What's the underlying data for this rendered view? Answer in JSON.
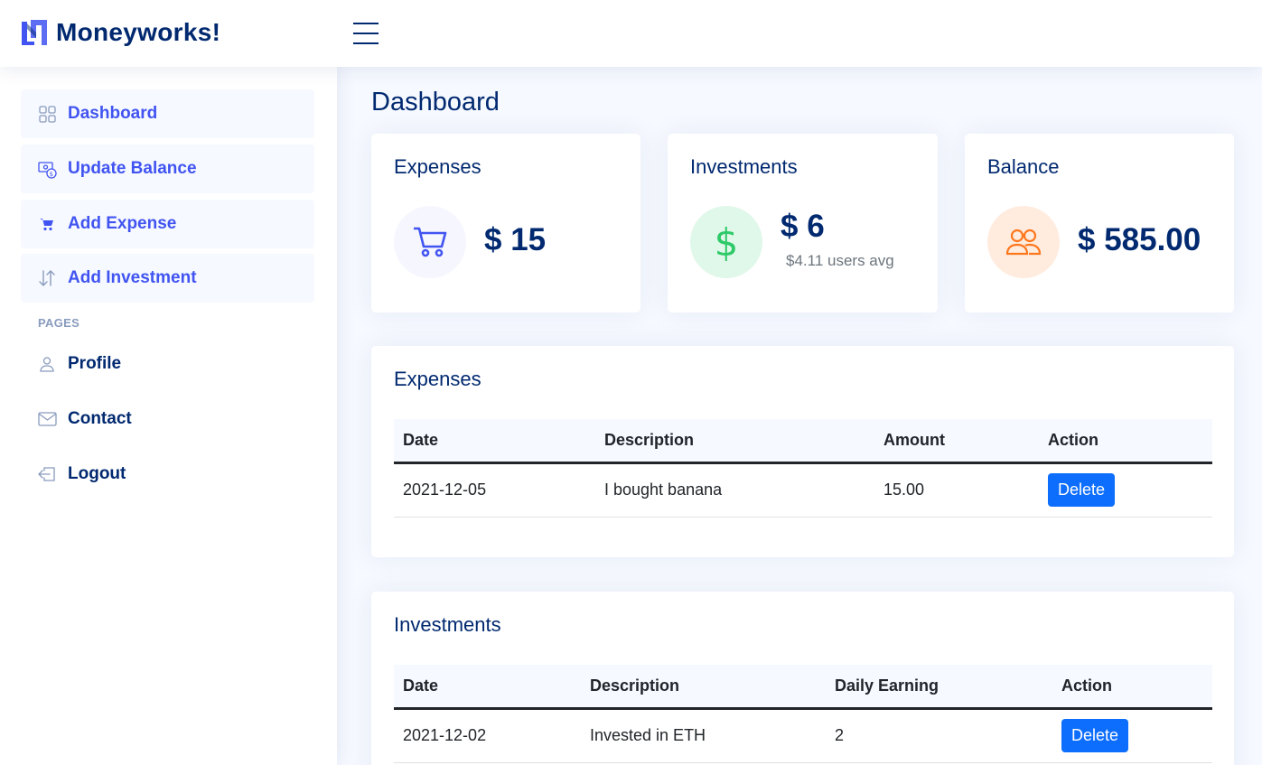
{
  "header": {
    "brand": "Moneyworks!"
  },
  "sidebar": {
    "items": [
      {
        "label": "Dashboard",
        "icon": "grid-icon"
      },
      {
        "label": "Update Balance",
        "icon": "cash-coin-icon"
      },
      {
        "label": "Add Expense",
        "icon": "cart-icon"
      },
      {
        "label": "Add Investment",
        "icon": "arrow-down-up-icon"
      }
    ],
    "pages_heading": "PAGES",
    "pages": [
      {
        "label": "Profile",
        "icon": "person-icon"
      },
      {
        "label": "Contact",
        "icon": "envelope-icon"
      },
      {
        "label": "Logout",
        "icon": "box-arrow-in-left-icon"
      }
    ]
  },
  "main": {
    "title": "Dashboard",
    "summary": [
      {
        "title": "Expenses",
        "value": "$ 15",
        "icon": "cart-icon",
        "color": "#4154f1",
        "bg": "#f6f6fe"
      },
      {
        "title": "Investments",
        "value": "$ 6",
        "sub": "$4.11 users avg",
        "icon": "currency-dollar-icon",
        "color": "#2eca6a",
        "bg": "#e0f8e9"
      },
      {
        "title": "Balance",
        "value": "$ 585.00",
        "icon": "people-icon",
        "color": "#ff771d",
        "bg": "#ffecdf"
      }
    ],
    "expenses": {
      "title": "Expenses",
      "headers": [
        "Date",
        "Description",
        "Amount",
        "Action"
      ],
      "rows": [
        {
          "date": "2021-12-05",
          "description": "I bought banana",
          "amount": "15.00",
          "action": "Delete"
        }
      ]
    },
    "investments": {
      "title": "Investments",
      "headers": [
        "Date",
        "Description",
        "Daily Earning",
        "Action"
      ],
      "rows": [
        {
          "date": "2021-12-02",
          "description": "Invested in ETH",
          "earning": "2",
          "action": "Delete"
        }
      ]
    }
  }
}
